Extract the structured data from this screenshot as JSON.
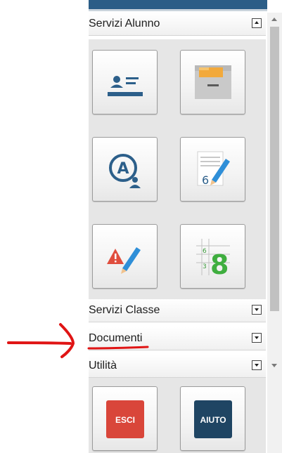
{
  "sections": {
    "servizi_alunno": {
      "label": "Servizi Alunno"
    },
    "servizi_classe": {
      "label": "Servizi Classe"
    },
    "documenti": {
      "label": "Documenti"
    },
    "utilita": {
      "label": "Utilità"
    }
  },
  "tiles": {
    "anagrafica": {
      "icon": "student-card-icon"
    },
    "archivio": {
      "icon": "file-drawer-icon"
    },
    "assenze": {
      "icon": "absence-user-icon"
    },
    "voti": {
      "icon": "grade-pencil-icon"
    },
    "note": {
      "icon": "warning-pencil-icon"
    },
    "tabellone": {
      "icon": "grades-grid-icon"
    },
    "esci": {
      "label": "ESCI",
      "color": "#d9463a"
    },
    "aiuto": {
      "label": "AIUTO",
      "color": "#1f4563"
    }
  },
  "colors": {
    "header_bar": "#2b5d87",
    "annotation": "#e01414"
  }
}
